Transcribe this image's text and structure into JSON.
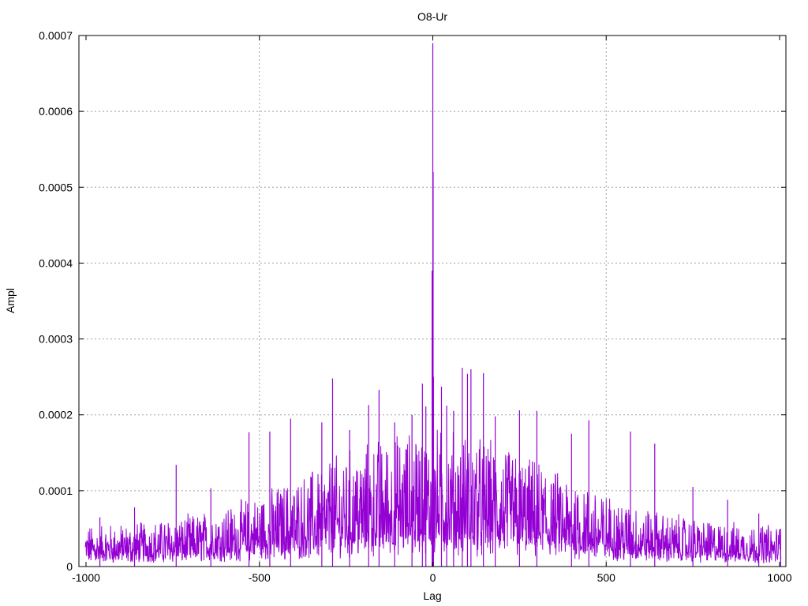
{
  "chart_data": {
    "type": "line",
    "title": "O8-Ur",
    "xlabel": "Lag",
    "ylabel": "Ampl",
    "xlim": [
      -1010,
      1010
    ],
    "ylim": [
      0,
      0.0007
    ],
    "grid": true,
    "x_ticks": [
      -1000,
      -500,
      0,
      500,
      1000
    ],
    "x_tick_labels": [
      "-1000",
      "-500",
      "0",
      "500",
      "1000"
    ],
    "y_ticks": [
      0,
      0.0001,
      0.0002,
      0.0003,
      0.0004,
      0.0005,
      0.0006,
      0.0007
    ],
    "y_tick_labels": [
      "0",
      "0.0001",
      "0.0002",
      "0.0003",
      "0.0004",
      "0.0005",
      "0.0006",
      "0.0007"
    ],
    "series_color": "#9400d3",
    "peaks": [
      {
        "x": 0,
        "y": 0.00069
      },
      {
        "x": 1,
        "y": 0.00052
      },
      {
        "x": -2,
        "y": 0.00039
      },
      {
        "x": -1,
        "y": 0.00026
      },
      {
        "x": 2,
        "y": 0.00025
      },
      {
        "x": -289,
        "y": 0.000248
      },
      {
        "x": 85,
        "y": 0.000262
      },
      {
        "x": 110,
        "y": 0.00026
      },
      {
        "x": 146,
        "y": 0.000255
      },
      {
        "x": 100,
        "y": 0.000254
      },
      {
        "x": -30,
        "y": 0.000241
      },
      {
        "x": 25,
        "y": 0.000237
      },
      {
        "x": -155,
        "y": 0.000233
      },
      {
        "x": -20,
        "y": 0.000211
      },
      {
        "x": -185,
        "y": 0.000213
      },
      {
        "x": 60,
        "y": 0.000205
      },
      {
        "x": 40,
        "y": 0.000212
      },
      {
        "x": 250,
        "y": 0.000206
      },
      {
        "x": 300,
        "y": 0.000205
      },
      {
        "x": 180,
        "y": 0.000198
      },
      {
        "x": -60,
        "y": 0.0002
      },
      {
        "x": -410,
        "y": 0.000195
      },
      {
        "x": -320,
        "y": 0.00019
      },
      {
        "x": -530,
        "y": 0.000177
      },
      {
        "x": -470,
        "y": 0.000178
      },
      {
        "x": 450,
        "y": 0.000193
      },
      {
        "x": 570,
        "y": 0.000178
      },
      {
        "x": 400,
        "y": 0.000175
      },
      {
        "x": -240,
        "y": 0.00018
      },
      {
        "x": -110,
        "y": 0.00019
      },
      {
        "x": 640,
        "y": 0.000162
      },
      {
        "x": -740,
        "y": 0.000134
      },
      {
        "x": 750,
        "y": 0.000105
      },
      {
        "x": -640,
        "y": 0.000103
      },
      {
        "x": 850,
        "y": 8.8e-05
      },
      {
        "x": -860,
        "y": 7.8e-05
      },
      {
        "x": 940,
        "y": 7e-05
      },
      {
        "x": -960,
        "y": 6.5e-05
      },
      {
        "x": 1003,
        "y": 5e-05
      }
    ]
  }
}
